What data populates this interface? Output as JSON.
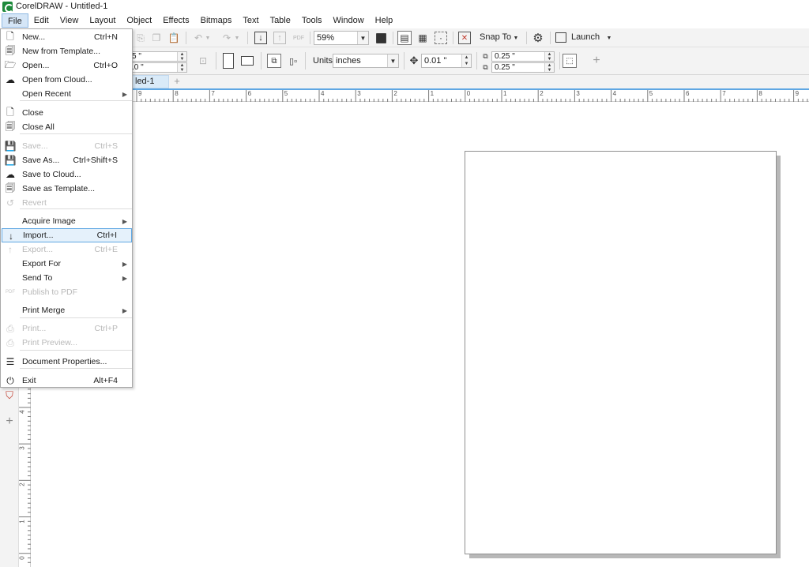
{
  "window": {
    "title": "CorelDRAW - Untitled-1"
  },
  "menubar": {
    "items": [
      "File",
      "Edit",
      "View",
      "Layout",
      "Object",
      "Effects",
      "Bitmaps",
      "Text",
      "Table",
      "Tools",
      "Window",
      "Help"
    ]
  },
  "toolbar": {
    "zoom_value": "59%",
    "snap_label": "Snap To",
    "launch_label": "Launch"
  },
  "property_bar": {
    "width_value": "5 \"",
    "height_value": ".0 \"",
    "units_label": "Units:",
    "units_value": "inches",
    "nudge_value": "0.01 \"",
    "dup_x_value": "0.25 \"",
    "dup_y_value": "0.25 \""
  },
  "document_tab": {
    "label": "led-1"
  },
  "rulers": {
    "horizontal_labels": [
      "9",
      "8",
      "7",
      "6",
      "5",
      "4",
      "3",
      "2",
      "1",
      "0",
      "1",
      "2",
      "3",
      "4",
      "5",
      "6",
      "7",
      "8",
      "9"
    ],
    "vertical_labels": [
      "4",
      "3",
      "2",
      "1",
      "0"
    ]
  },
  "file_menu": {
    "items": [
      {
        "label": "New...",
        "shortcut": "Ctrl+N",
        "icon": "new-document-icon",
        "state": "enabled"
      },
      {
        "label": "New from Template...",
        "shortcut": "",
        "icon": "new-template-icon",
        "state": "enabled"
      },
      {
        "label": "Open...",
        "shortcut": "Ctrl+O",
        "icon": "open-folder-icon",
        "state": "enabled"
      },
      {
        "label": "Open from Cloud...",
        "shortcut": "",
        "icon": "cloud-download-icon",
        "state": "enabled"
      },
      {
        "label": "Open Recent",
        "shortcut": "",
        "icon": "",
        "state": "submenu"
      },
      {
        "label": "Close",
        "shortcut": "",
        "icon": "close-document-icon",
        "state": "enabled"
      },
      {
        "label": "Close All",
        "shortcut": "",
        "icon": "close-all-icon",
        "state": "enabled"
      },
      {
        "label": "Save...",
        "shortcut": "Ctrl+S",
        "icon": "save-icon",
        "state": "disabled"
      },
      {
        "label": "Save As...",
        "shortcut": "Ctrl+Shift+S",
        "icon": "save-as-icon",
        "state": "enabled"
      },
      {
        "label": "Save to Cloud...",
        "shortcut": "",
        "icon": "cloud-upload-icon",
        "state": "enabled"
      },
      {
        "label": "Save as Template...",
        "shortcut": "",
        "icon": "save-template-icon",
        "state": "enabled"
      },
      {
        "label": "Revert",
        "shortcut": "",
        "icon": "revert-icon",
        "state": "disabled"
      },
      {
        "label": "Acquire Image",
        "shortcut": "",
        "icon": "",
        "state": "submenu"
      },
      {
        "label": "Import...",
        "shortcut": "Ctrl+I",
        "icon": "import-icon",
        "state": "highlighted"
      },
      {
        "label": "Export...",
        "shortcut": "Ctrl+E",
        "icon": "export-icon",
        "state": "disabled"
      },
      {
        "label": "Export For",
        "shortcut": "",
        "icon": "",
        "state": "submenu"
      },
      {
        "label": "Send To",
        "shortcut": "",
        "icon": "",
        "state": "submenu"
      },
      {
        "label": "Publish to PDF",
        "shortcut": "",
        "icon": "pdf-icon",
        "state": "disabled"
      },
      {
        "label": "Print Merge",
        "shortcut": "",
        "icon": "",
        "state": "submenu"
      },
      {
        "label": "Print...",
        "shortcut": "Ctrl+P",
        "icon": "print-icon",
        "state": "disabled"
      },
      {
        "label": "Print Preview...",
        "shortcut": "",
        "icon": "print-preview-icon",
        "state": "disabled"
      },
      {
        "label": "Document Properties...",
        "shortcut": "",
        "icon": "document-properties-icon",
        "state": "enabled"
      },
      {
        "label": "Exit",
        "shortcut": "Alt+F4",
        "icon": "power-icon",
        "state": "enabled"
      }
    ]
  },
  "colors": {
    "menu_highlight_border": "#5fa7e3",
    "menu_highlight_fill": "#e5f1fb",
    "active_tab": "#d9eaf8",
    "app_green": "#1e8a3c"
  }
}
